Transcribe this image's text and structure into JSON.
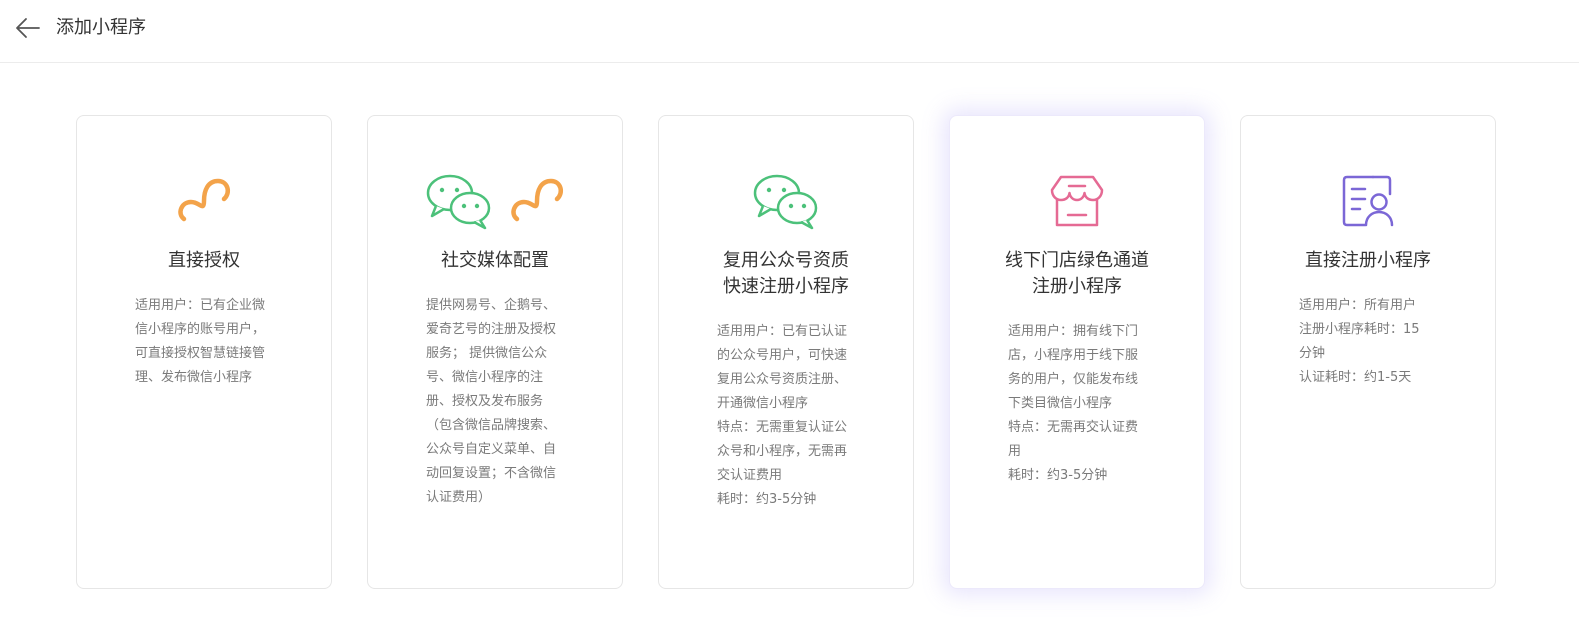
{
  "header": {
    "back_icon": "arrow-left-icon",
    "title": "添加小程序"
  },
  "colors": {
    "orange": "#F3A34A",
    "green": "#4CC17A",
    "pink": "#E56A94",
    "purple": "#7B67D6"
  },
  "cards": [
    {
      "icons": [
        "miniprogram-icon"
      ],
      "title_lines": [
        "直接授权"
      ],
      "desc_lines": [
        "适用用户：已有企业微\n信小程序的账号用户，\n可直接授权智慧链接管\n理、发布微信小程序"
      ]
    },
    {
      "icons": [
        "wechat-icon",
        "miniprogram-icon"
      ],
      "title_lines": [
        "社交媒体配置"
      ],
      "desc_lines": [
        "提供网易号、企鹅号、\n爱奇艺号的注册及授权\n服务； 提供微信公众\n号、微信小程序的注\n册、授权及发布服务\n（包含微信品牌搜索、\n公众号自定义菜单、自\n动回复设置；不含微信\n认证费用）"
      ]
    },
    {
      "icons": [
        "wechat-icon"
      ],
      "title_lines": [
        "复用公众号资质",
        "快速注册小程序"
      ],
      "desc_lines": [
        "适用用户：已有已认证\n的公众号用户，可快速\n复用公众号资质注册、\n开通微信小程序",
        "特点：无需重复认证公\n众号和小程序，无需再\n交认证费用",
        "耗时：约3-5分钟"
      ]
    },
    {
      "icons": [
        "store-icon"
      ],
      "title_lines": [
        "线下门店绿色通道",
        "注册小程序"
      ],
      "desc_lines": [
        "适用用户：拥有线下门\n店，小程序用于线下服\n务的用户，仅能发布线\n下类目微信小程序",
        "特点：无需再交认证费\n用",
        "耗时：约3-5分钟"
      ],
      "active": true
    },
    {
      "icons": [
        "profile-id-icon"
      ],
      "title_lines": [
        "直接注册小程序"
      ],
      "desc_lines": [
        "适用用户：所有用户",
        "注册小程序耗时：15\n分钟",
        "认证耗时：约1-5天"
      ]
    }
  ]
}
